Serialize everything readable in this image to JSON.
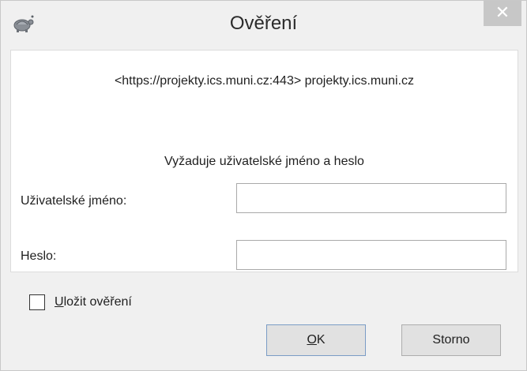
{
  "window": {
    "title": "Ověření",
    "close_glyph": "✕"
  },
  "dialog": {
    "realm": "<https://projekty.ics.muni.cz:443> projekty.ics.muni.cz",
    "requires": "Vyžaduje uživatelské jméno a heslo",
    "username_label": "Uživatelské jméno:",
    "username_value": "",
    "password_label": "Heslo:",
    "password_value": ""
  },
  "save_auth": {
    "label_access_key": "U",
    "label_rest": "ložit ověření",
    "checked": false
  },
  "buttons": {
    "ok_access_key": "O",
    "ok_rest": "K",
    "cancel_label": "Storno"
  },
  "icons": {
    "app": "tortoise-icon",
    "close": "close-icon"
  },
  "colors": {
    "window_bg": "#f0f0f0",
    "panel_bg": "#ffffff",
    "close_button_bg": "#c7c7c7",
    "button_bg": "#e1e1e1"
  }
}
